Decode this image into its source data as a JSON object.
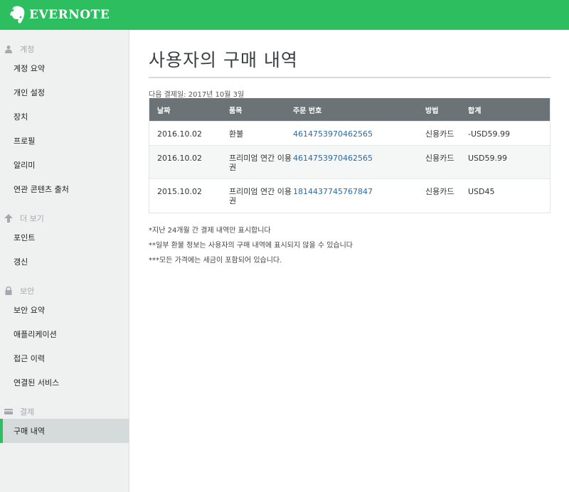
{
  "app": {
    "name": "EVERNOTE",
    "brand_color": "#2dbe60"
  },
  "sidebar": {
    "sections": [
      {
        "title": "계정",
        "icon": "user-icon",
        "items": [
          "계정 요약",
          "개인 설정",
          "장치",
          "프로필",
          "알리미",
          "연관 콘텐츠 출처"
        ]
      },
      {
        "title": "더 보기",
        "icon": "upgrade-arrow-icon",
        "items": [
          "포인트",
          "갱신"
        ]
      },
      {
        "title": "보안",
        "icon": "lock-icon",
        "items": [
          "보안 요약",
          "애플리케이션",
          "접근 이력",
          "연결된 서비스"
        ]
      },
      {
        "title": "결제",
        "icon": "credit-card-icon",
        "items": [
          "구매 내역"
        ]
      }
    ],
    "active_item": "구매 내역"
  },
  "main": {
    "title": "사용자의 구매 내역",
    "next_payment": "다음 결제일: 2017년 10월 3일",
    "table": {
      "headers": [
        "날짜",
        "품목",
        "주문 번호",
        "방법",
        "합계"
      ],
      "rows": [
        {
          "date": "2016.10.02",
          "item": "환불",
          "order": "4614753970462565",
          "method": "신용카드",
          "total": "-USD59.99"
        },
        {
          "date": "2016.10.02",
          "item": "프리미엄 연간 이용권",
          "order": "4614753970462565",
          "method": "신용카드",
          "total": "USD59.99"
        },
        {
          "date": "2015.10.02",
          "item": "프리미엄 연간 이용권",
          "order": "1814437745767847",
          "method": "신용카드",
          "total": "USD45"
        }
      ]
    },
    "notes": [
      "*지난 24개월 간 결제 내역만 표시합니다",
      "**일부 환불 정보는 사용자의 구매 내역에 표시되지 않을 수 있습니다",
      "***모든 가격에는 세금이 포함되어 있습니다."
    ]
  }
}
